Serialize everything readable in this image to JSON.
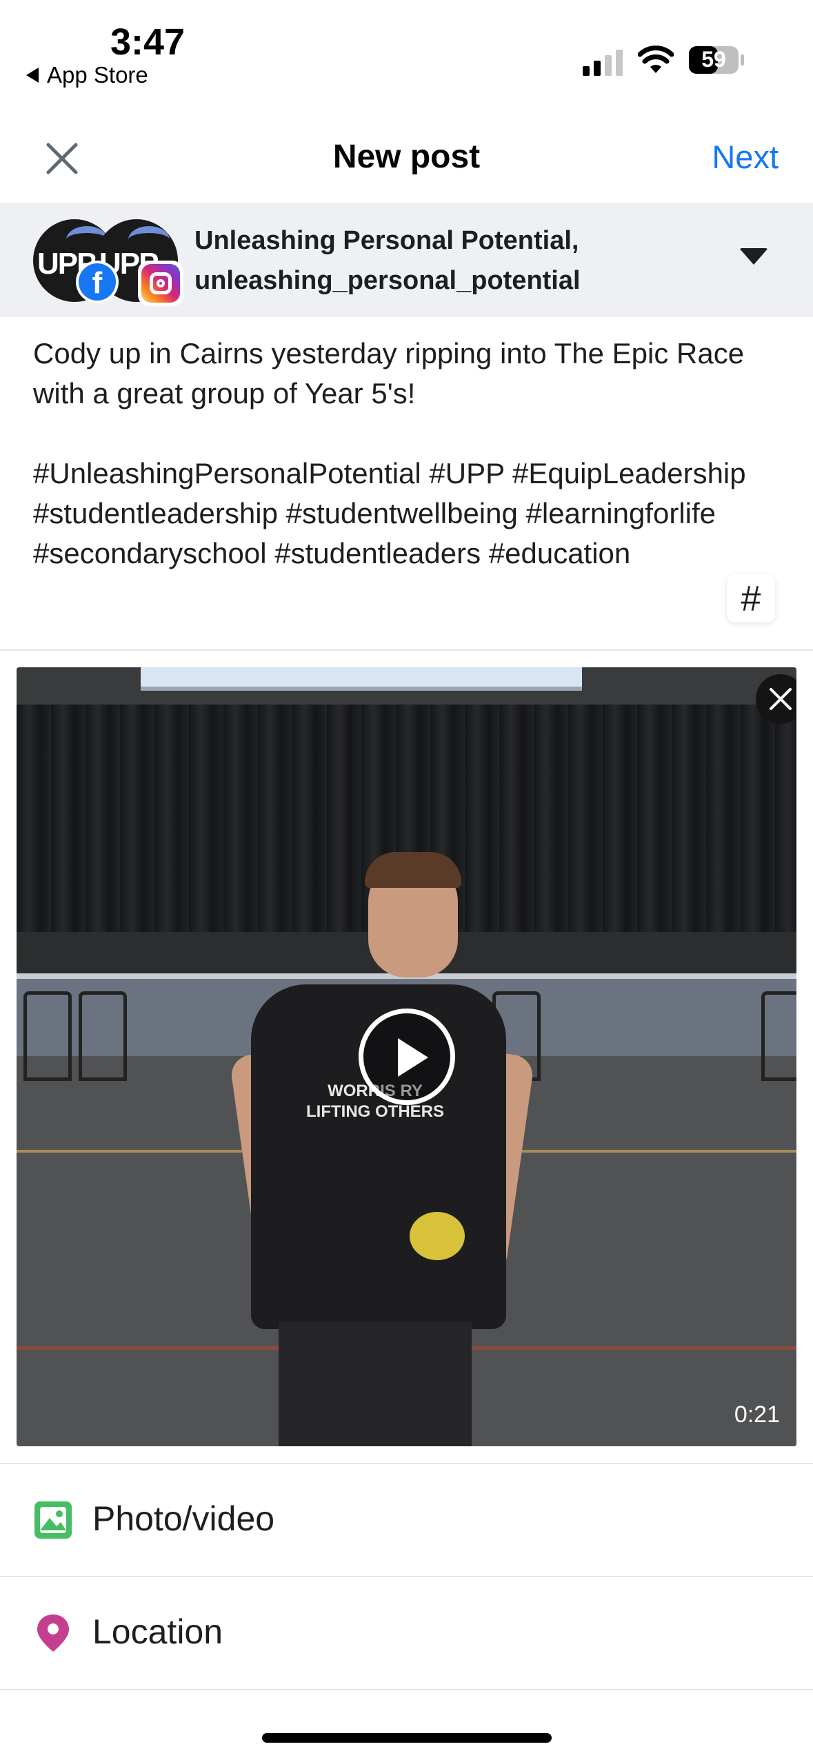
{
  "status_bar": {
    "time": "3:47",
    "back_app": "App Store",
    "battery": "59"
  },
  "header": {
    "title": "New post",
    "next_label": "Next"
  },
  "account": {
    "page_name": "Unleashing Personal Potential,",
    "ig_handle": "unleashing_personal_potential",
    "avatar_text": "UPP"
  },
  "caption": {
    "text": "Cody up in Cairns yesterday ripping into The Epic Race with a great group of Year 5's!\n\n#UnleashingPersonalPotential #UPP #EquipLeadership #studentleadership #studentwellbeing #learningforlife #secondaryschool #studentleaders #education",
    "hashtag_button": "#"
  },
  "video": {
    "duration": "0:21",
    "shirt_line1": "WORRIS RY",
    "shirt_line2": "LIFTING OTHERS"
  },
  "options": [
    {
      "label": "Photo/video",
      "icon": "photo-video-icon",
      "color": "#45bd62"
    },
    {
      "label": "Location",
      "icon": "location-pin-icon",
      "color": "#c43f8f"
    }
  ],
  "colors": {
    "accent": "#1877f2",
    "account_bg": "#eef0f3"
  }
}
